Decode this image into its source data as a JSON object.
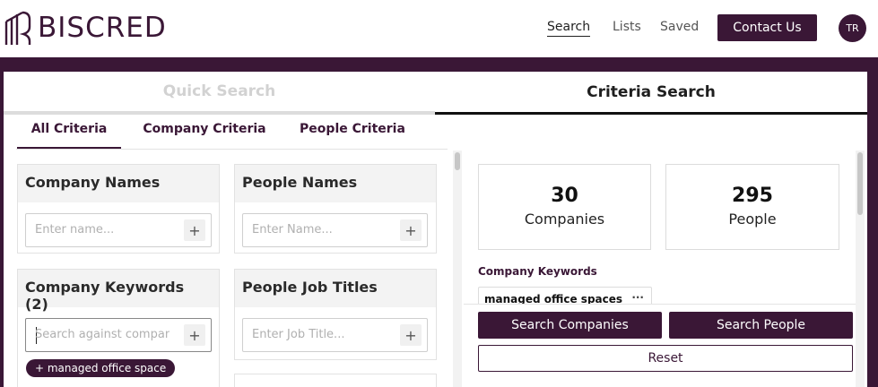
{
  "header": {
    "logo_text": "BISCRED",
    "nav": {
      "search": "Search",
      "lists": "Lists",
      "saved": "Saved"
    },
    "contact_label": "Contact Us",
    "avatar_initials": "TR"
  },
  "modes": {
    "quick": "Quick Search",
    "criteria": "Criteria Search"
  },
  "sub_tabs": {
    "all": "All Criteria",
    "company": "Company Criteria",
    "people": "People Criteria"
  },
  "filters": {
    "company_names": {
      "title": "Company Names",
      "placeholder": "Enter name..."
    },
    "people_names": {
      "title": "People Names",
      "placeholder": "Enter Name..."
    },
    "company_keywords": {
      "title": "Company Keywords (2)",
      "placeholder": "Search against company...",
      "chip": "+ managed office space"
    },
    "people_job_titles": {
      "title": "People Job Titles",
      "placeholder": "Enter Job Title..."
    },
    "plus_glyph": "+"
  },
  "results": {
    "companies_count": "30",
    "companies_label": "Companies",
    "people_count": "295",
    "people_label": "People",
    "keywords_heading": "Company Keywords",
    "keyword_tag": "managed office spaces",
    "more_glyph": "···"
  },
  "actions": {
    "search_companies": "Search Companies",
    "search_people": "Search People",
    "reset": "Reset"
  },
  "colors": {
    "brand": "#3a1736"
  }
}
